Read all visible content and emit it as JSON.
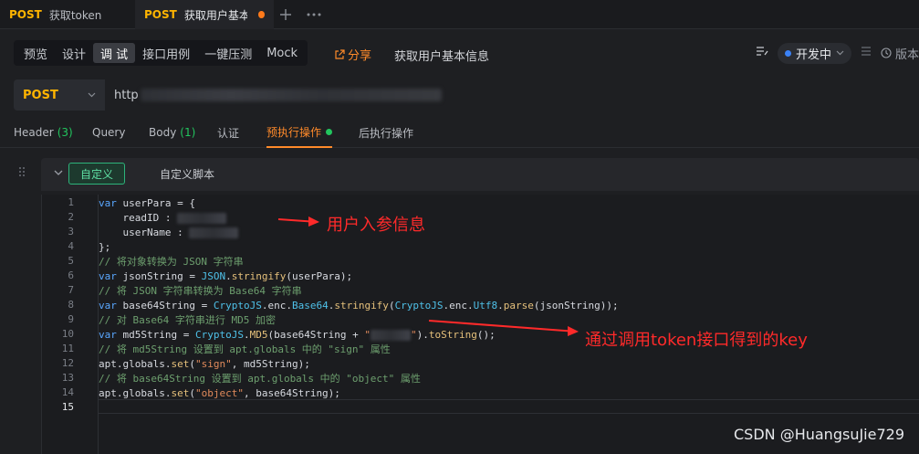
{
  "tabs": [
    {
      "method": "POST",
      "title": "获取token"
    },
    {
      "method": "POST",
      "title": "获取用户基本信"
    }
  ],
  "tabbar_icons": {
    "add": "plus-icon",
    "more": "more-icon"
  },
  "mode_tabs": [
    "预览",
    "设计",
    "调 试",
    "接口用例",
    "一键压测",
    "Mock"
  ],
  "active_mode": "调 试",
  "share_label": "分享",
  "api_name": "获取用户基本信息",
  "status_label": "开发中",
  "version_label": "版本",
  "method": "POST",
  "url_prefix": "http",
  "param_tabs": {
    "header": "Header",
    "header_count": "(3)",
    "query": "Query",
    "body": "Body",
    "body_count": "(1)",
    "auth": "认证",
    "pre": "预执行操作",
    "post": "后执行操作"
  },
  "script_panel": {
    "button": "自定义",
    "label": "自定义脚本"
  },
  "code_lines": [
    [
      {
        "c": "kw",
        "t": "var"
      },
      {
        "c": "txt",
        "t": " userPara = {"
      }
    ],
    [
      {
        "c": "txt",
        "t": "    readID : "
      },
      {
        "c": "redact",
        "t": ""
      }
    ],
    [
      {
        "c": "txt",
        "t": "    userName : "
      },
      {
        "c": "redact",
        "t": ""
      }
    ],
    [
      {
        "c": "txt",
        "t": "};"
      }
    ],
    [
      {
        "c": "cmt",
        "t": "// 将对象转换为 JSON 字符串"
      }
    ],
    [
      {
        "c": "kw",
        "t": "var"
      },
      {
        "c": "txt",
        "t": " jsonString = "
      },
      {
        "c": "obj",
        "t": "JSON"
      },
      {
        "c": "txt",
        "t": "."
      },
      {
        "c": "fn",
        "t": "stringify"
      },
      {
        "c": "txt",
        "t": "(userPara);"
      }
    ],
    [
      {
        "c": "cmt",
        "t": "// 将 JSON 字符串转换为 Base64 字符串"
      }
    ],
    [
      {
        "c": "kw",
        "t": "var"
      },
      {
        "c": "txt",
        "t": " base64String = "
      },
      {
        "c": "obj",
        "t": "CryptoJS"
      },
      {
        "c": "txt",
        "t": ".enc."
      },
      {
        "c": "obj",
        "t": "Base64"
      },
      {
        "c": "txt",
        "t": "."
      },
      {
        "c": "fn",
        "t": "stringify"
      },
      {
        "c": "txt",
        "t": "("
      },
      {
        "c": "obj",
        "t": "CryptoJS"
      },
      {
        "c": "txt",
        "t": ".enc."
      },
      {
        "c": "obj",
        "t": "Utf8"
      },
      {
        "c": "txt",
        "t": "."
      },
      {
        "c": "fn",
        "t": "parse"
      },
      {
        "c": "txt",
        "t": "(jsonString));"
      }
    ],
    [
      {
        "c": "cmt",
        "t": "// 对 Base64 字符串进行 MD5 加密"
      }
    ],
    [
      {
        "c": "kw",
        "t": "var"
      },
      {
        "c": "txt",
        "t": " md5String = "
      },
      {
        "c": "obj",
        "t": "CryptoJS"
      },
      {
        "c": "txt",
        "t": "."
      },
      {
        "c": "fn",
        "t": "MD5"
      },
      {
        "c": "txt",
        "t": "(base64String + "
      },
      {
        "c": "str",
        "t": "\""
      },
      {
        "c": "redact-sm",
        "t": ""
      },
      {
        "c": "str",
        "t": "\""
      },
      {
        "c": "txt",
        "t": ")."
      },
      {
        "c": "fn",
        "t": "toString"
      },
      {
        "c": "txt",
        "t": "();"
      }
    ],
    [
      {
        "c": "cmt",
        "t": "// 将 md5String 设置到 apt.globals 中的 \"sign\" 属性"
      }
    ],
    [
      {
        "c": "txt",
        "t": "apt.globals."
      },
      {
        "c": "fn",
        "t": "set"
      },
      {
        "c": "txt",
        "t": "("
      },
      {
        "c": "str",
        "t": "\"sign\""
      },
      {
        "c": "txt",
        "t": ", md5String);"
      }
    ],
    [
      {
        "c": "cmt",
        "t": "// 将 base64String 设置到 apt.globals 中的 \"object\" 属性"
      }
    ],
    [
      {
        "c": "txt",
        "t": "apt.globals."
      },
      {
        "c": "fn",
        "t": "set"
      },
      {
        "c": "txt",
        "t": "("
      },
      {
        "c": "str",
        "t": "\"object\""
      },
      {
        "c": "txt",
        "t": ", base64String);"
      }
    ],
    []
  ],
  "annotations": {
    "user_info": "用户入参信息",
    "token_key": "通过调用token接口得到的key",
    "color": "#ff2a2a"
  },
  "watermark": "CSDN @HuangsuJie729",
  "colors": {
    "accent_orange": "#ff8a2a",
    "post_yellow": "#ffb400",
    "success_green": "#22c55e",
    "status_blue": "#3b82f6"
  }
}
